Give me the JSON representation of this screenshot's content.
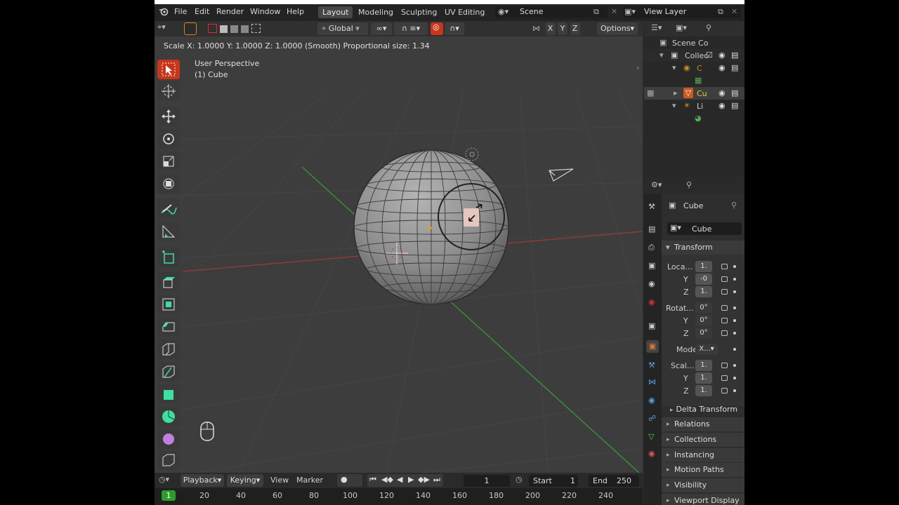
{
  "menu": {
    "items": [
      "File",
      "Edit",
      "Render",
      "Window",
      "Help"
    ]
  },
  "workspaces": {
    "tabs": [
      "Layout",
      "Modeling",
      "Sculpting",
      "UV Editing"
    ]
  },
  "scene": {
    "name": "Scene",
    "view_layer": "View Layer"
  },
  "header": {
    "orientation": "Global",
    "axes": [
      "X",
      "Y",
      "Z"
    ],
    "options_label": "Options"
  },
  "status": {
    "scale_text": "Scale X: 1.0000   Y: 1.0000  Z: 1.0000 (Smooth) Proportional size: 1.34"
  },
  "viewport": {
    "perspective": "User Perspective",
    "object": "(1) Cube"
  },
  "outliner": {
    "rows": [
      {
        "label": "Scene Co",
        "color": "#cfcfcf"
      },
      {
        "label": "Collec",
        "color": "#cfcfcf"
      },
      {
        "label": "C",
        "color": "#c98c2a"
      },
      {
        "label": "Cu",
        "color": "#e7c94a"
      },
      {
        "label": "Li",
        "color": "#cfcfcf"
      }
    ]
  },
  "properties": {
    "object_name": "Cube",
    "data_name": "Cube",
    "transform_label": "Transform",
    "location_label": "Loca...",
    "rotation_label": "Rotat...",
    "mode_label": "Mode",
    "mode_value": "X...",
    "scale_label": "Scal...",
    "loc_values": [
      "1.",
      "-0",
      "1."
    ],
    "rot_values": [
      "0°",
      "0°",
      "0°"
    ],
    "scale_values": [
      "1.",
      "1.",
      "1."
    ],
    "axis_y": "Y",
    "axis_z": "Z",
    "delta_transform": "Delta Transform",
    "panels": [
      "Relations",
      "Collections",
      "Instancing",
      "Motion Paths",
      "Visibility",
      "Viewport Display"
    ]
  },
  "timeline": {
    "playback": "Playback",
    "keying": "Keying",
    "view": "View",
    "marker": "Marker",
    "current_frame": "1",
    "start_label": "Start",
    "start_value": "1",
    "end_label": "End",
    "end_value": "250",
    "ruler": [
      "1",
      "20",
      "40",
      "60",
      "80",
      "100",
      "120",
      "140",
      "160",
      "180",
      "200",
      "220",
      "240"
    ]
  },
  "colors": {
    "active_tool": "#c8361a",
    "x_axis": "#9a3a3a",
    "y_axis": "#3d8a3d",
    "current_frame": "#2d9c2d"
  }
}
